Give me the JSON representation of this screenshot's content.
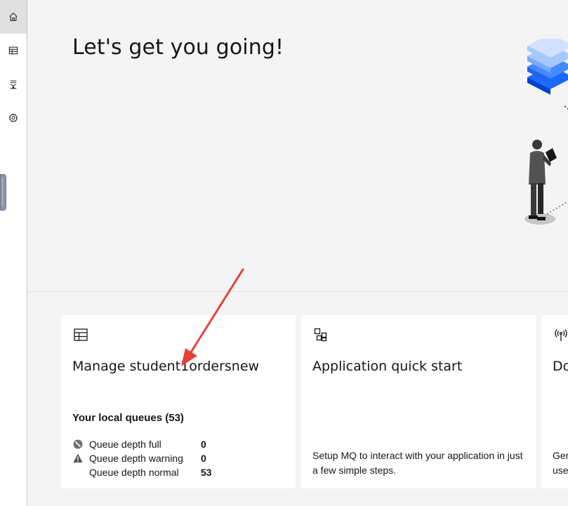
{
  "nav": {
    "items": [
      {
        "name": "home",
        "icon": "home-icon",
        "active": true
      },
      {
        "name": "local-queues",
        "icon": "table-icon",
        "active": false
      },
      {
        "name": "topology",
        "icon": "topology-icon",
        "active": false
      },
      {
        "name": "settings",
        "icon": "gear-icon",
        "active": false
      }
    ]
  },
  "hero": {
    "title": "Let's get you going!"
  },
  "cards": {
    "manage": {
      "icon": "table-icon",
      "title": "Manage student1ordersnew",
      "subtitle": "Your local queues (53)",
      "stats": [
        {
          "icon": "blocked-icon",
          "label": "Queue depth full",
          "value": "0"
        },
        {
          "icon": "warning-icon",
          "label": "Queue depth warning",
          "value": "0"
        },
        {
          "icon": "",
          "label": "Queue depth normal",
          "value": "53"
        }
      ]
    },
    "quickstart": {
      "icon": "apps-icon",
      "title": "Application quick start",
      "description": "Setup MQ to interact with your application in just a few simple steps."
    },
    "download": {
      "icon": "antenna-icon",
      "title": "Do",
      "description_line1": "Ger",
      "description_line2": "use"
    }
  },
  "colors": {
    "page_bg": "#f4f4f4",
    "card_bg": "#ffffff",
    "annotation_arrow": "#e8403a",
    "illustration_blue": "#4589ff"
  }
}
